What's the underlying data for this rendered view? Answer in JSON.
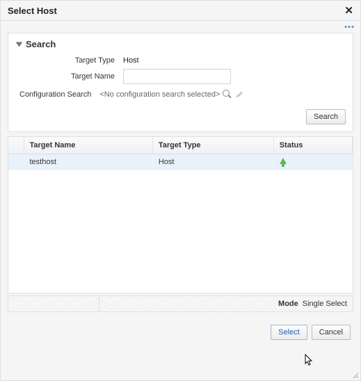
{
  "dialog": {
    "title": "Select Host"
  },
  "search": {
    "header": "Search",
    "target_type_label": "Target Type",
    "target_type_value": "Host",
    "target_name_label": "Target Name",
    "target_name_value": "",
    "config_label": "Configuration Search",
    "config_placeholder": "<No configuration search selected>",
    "search_button": "Search"
  },
  "table": {
    "columns": {
      "c1": "Target Name",
      "c2": "Target Type",
      "c3": "Status"
    },
    "rows": [
      {
        "name": "testhost",
        "type": "Host",
        "status": "up"
      }
    ]
  },
  "footer": {
    "mode_label": "Mode",
    "mode_value": "Single Select"
  },
  "buttons": {
    "select": "Select",
    "cancel": "Cancel"
  }
}
